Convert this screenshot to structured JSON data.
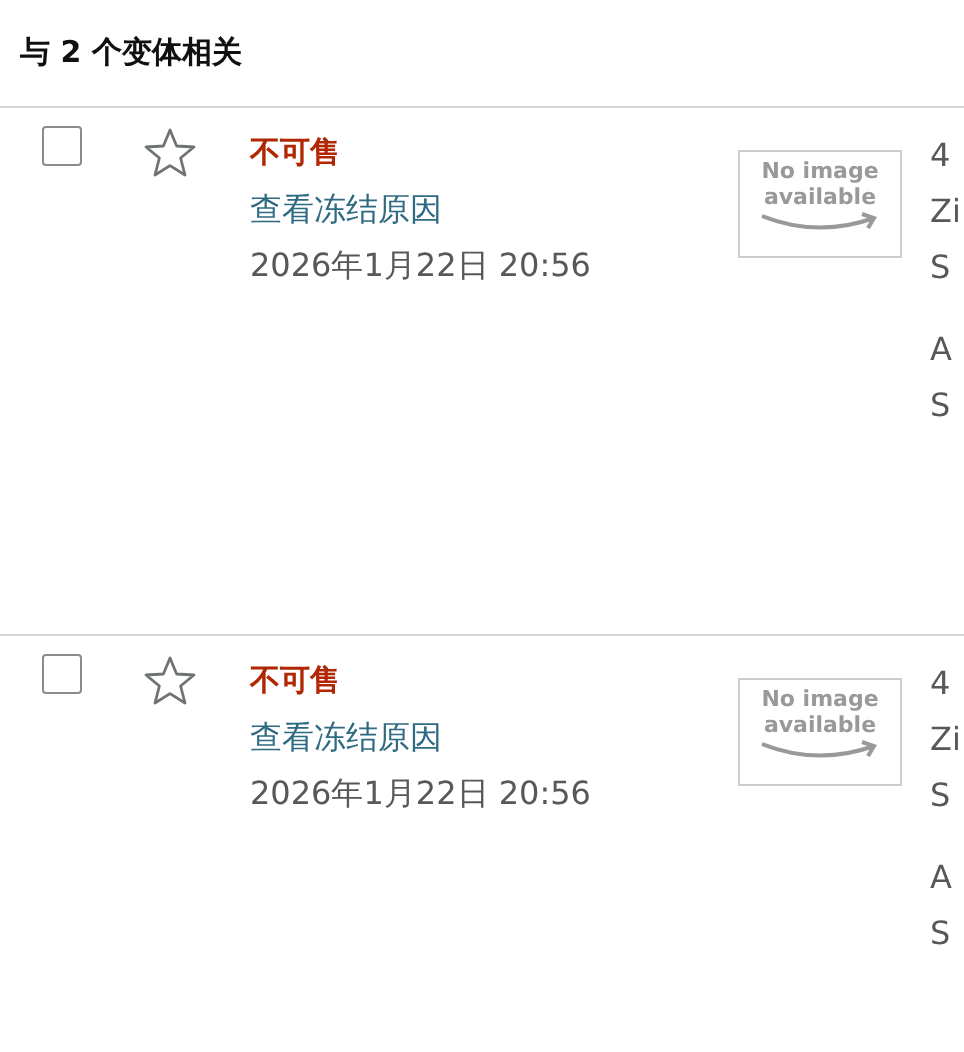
{
  "header": {
    "title": "与 2 个变体相关"
  },
  "rows": [
    {
      "checked": false,
      "starred": false,
      "status": "不可售",
      "link": "查看冻结原因",
      "date": "2026年1月22日 20:56",
      "image": {
        "line_1": "No image",
        "line_2": "available"
      },
      "details": [
        "4",
        "Zi",
        "S"
      ],
      "ids": [
        "A",
        "S"
      ]
    },
    {
      "checked": false,
      "starred": false,
      "status": "不可售",
      "link": "查看冻结原因",
      "date": "2026年1月22日 20:56",
      "image": {
        "line_1": "No image",
        "line_2": "available"
      },
      "details": [
        "4",
        "Zi",
        "S"
      ],
      "ids": [
        "A",
        "S"
      ]
    }
  ]
}
